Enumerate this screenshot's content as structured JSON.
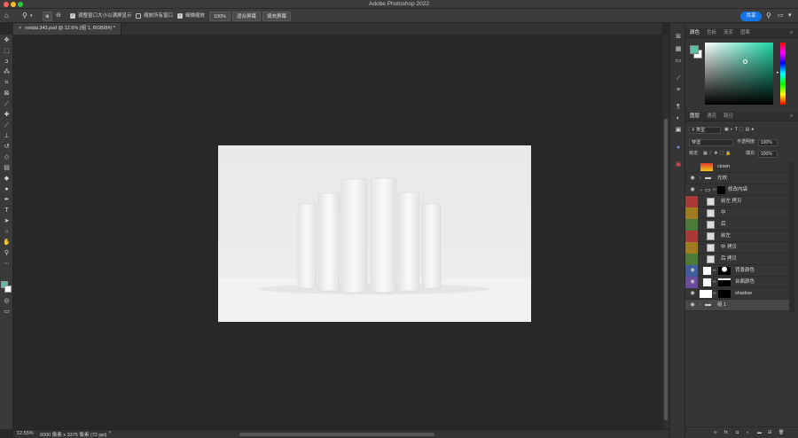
{
  "window": {
    "title": "Adobe Photoshop 2022",
    "traffic_colors": [
      "#ff5f57",
      "#febc2e",
      "#28c840"
    ]
  },
  "options_bar": {
    "resize_windows_label": "调整窗口大小以满屏显示",
    "zoom_all_label": "缩放所有窗口",
    "scrubby_zoom_label": "细微缩放",
    "zoom_value": "100%",
    "fit_screen_label": "适合屏幕",
    "fill_screen_label": "填充屏幕",
    "share_label": "共享"
  },
  "document_tab": {
    "close_glyph": "×",
    "title": "neidai.343.psd @ 12.6% (组 1, RGB/8#) *"
  },
  "status_bar": {
    "zoom": "12.55%",
    "dimensions": "6000 像素 x 3375 像素 (72 ppi)",
    "arrow": "›"
  },
  "color_panel": {
    "tabs": [
      "颜色",
      "色板",
      "渐变",
      "图案"
    ],
    "foreground": "#5bbfaa",
    "background": "#ffffff",
    "hue_color": "#1ad6a5"
  },
  "layers_panel": {
    "tabs": [
      "图层",
      "通道",
      "路径"
    ],
    "filter_label": "类型",
    "blend_mode": "穿透",
    "opacity_label": "不透明度:",
    "opacity_value": "100%",
    "lock_label": "锁定:",
    "fill_label": "填充:",
    "fill_value": "100%",
    "layers": [
      {
        "name": "clown",
        "type": "pixel",
        "tag": "none",
        "visible": false
      },
      {
        "name": "光效",
        "type": "group",
        "tag": "none",
        "visible": true
      },
      {
        "name": "修改内袋",
        "type": "group-open",
        "tag": "none",
        "visible": true
      },
      {
        "name": "前左 拷贝",
        "type": "smart",
        "tag": "red",
        "visible": false
      },
      {
        "name": "中",
        "type": "smart",
        "tag": "orange",
        "visible": false
      },
      {
        "name": "后",
        "type": "smart",
        "tag": "green",
        "visible": false
      },
      {
        "name": "前左",
        "type": "smart",
        "tag": "red",
        "visible": false
      },
      {
        "name": "中 拷贝",
        "type": "smart",
        "tag": "orange",
        "visible": false
      },
      {
        "name": "后 拷贝",
        "type": "smart",
        "tag": "green",
        "visible": false
      },
      {
        "name": "背景颜色",
        "type": "mask",
        "tag": "blue",
        "visible": true
      },
      {
        "name": "台面颜色",
        "type": "mask",
        "tag": "violet",
        "visible": true
      },
      {
        "name": "shadow",
        "type": "mask-white",
        "tag": "none",
        "visible": true
      },
      {
        "name": "组 1",
        "type": "group",
        "tag": "none",
        "visible": true
      }
    ],
    "bottom_icons": [
      "link-icon",
      "fx-icon",
      "mask-icon",
      "adjustment-icon",
      "folder-icon",
      "new-layer-icon",
      "trash-icon"
    ]
  },
  "tag_colors": {
    "none": "transparent",
    "red": "#a83a3a",
    "orange": "#a07a1e",
    "green": "#4c7a3a",
    "blue": "#3c5d9a",
    "violet": "#6a4a9a"
  }
}
